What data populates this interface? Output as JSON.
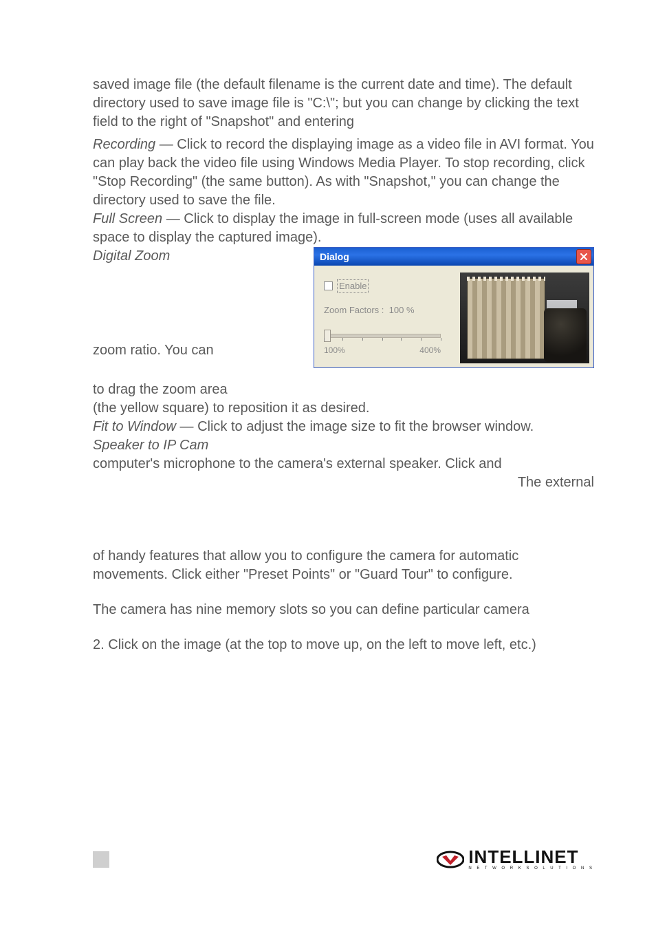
{
  "p1a": "saved image file (the default filename is the current date and time). The default directory used to save image file is \"C:\\\"; but you can change by clicking the text field to the right of \"Snapshot\" and entering",
  "recording_label": "Recording",
  "recording_text": " — Click to record the displaying image as a video file in AVI format. You can play back the video file using Windows Media Player. To stop recording, click \"Stop Recording\" (the same button). As with \"Snapshot,\" you can change the directory used to save the file.",
  "fullscreen_label": "Full Screen",
  "fullscreen_text": " — Click to display the image in full-screen mode (uses all available space to display the captured image).",
  "digital_zoom_label": "Digital Zoom",
  "zoom_ratio_text": "zoom ratio. You can",
  "drag_text": "to drag the zoom area",
  "yellow_square_text": "(the yellow square) to reposition it as desired.",
  "fit_label": "Fit to Window",
  "fit_text": " — Click to adjust the image size to fit the browser window.",
  "speaker_label": "Speaker to IP Cam",
  "speaker_text": "computer's microphone to the camera's external speaker. Click and",
  "external_text": "The external",
  "handy_text": "of handy features that allow you to configure the camera for automatic movements. Click either \"Preset Points\" or \"Guard Tour\" to configure.",
  "nine_text": "The camera has nine memory slots so you can define particular camera",
  "step2": "2.",
  "step2_text": "Click on the image (at the top to move up, on the left to move left, etc.)",
  "dialog": {
    "title": "Dialog",
    "enable": "Enable",
    "zoom_factors": "Zoom Factors :",
    "zoom_value": "100",
    "zoom_pct": "%",
    "slider_min": "100%",
    "slider_max": "400%"
  },
  "logo": {
    "name": "INTELLINET",
    "sub": "N E T W O R K   S O L U T I O N S"
  }
}
